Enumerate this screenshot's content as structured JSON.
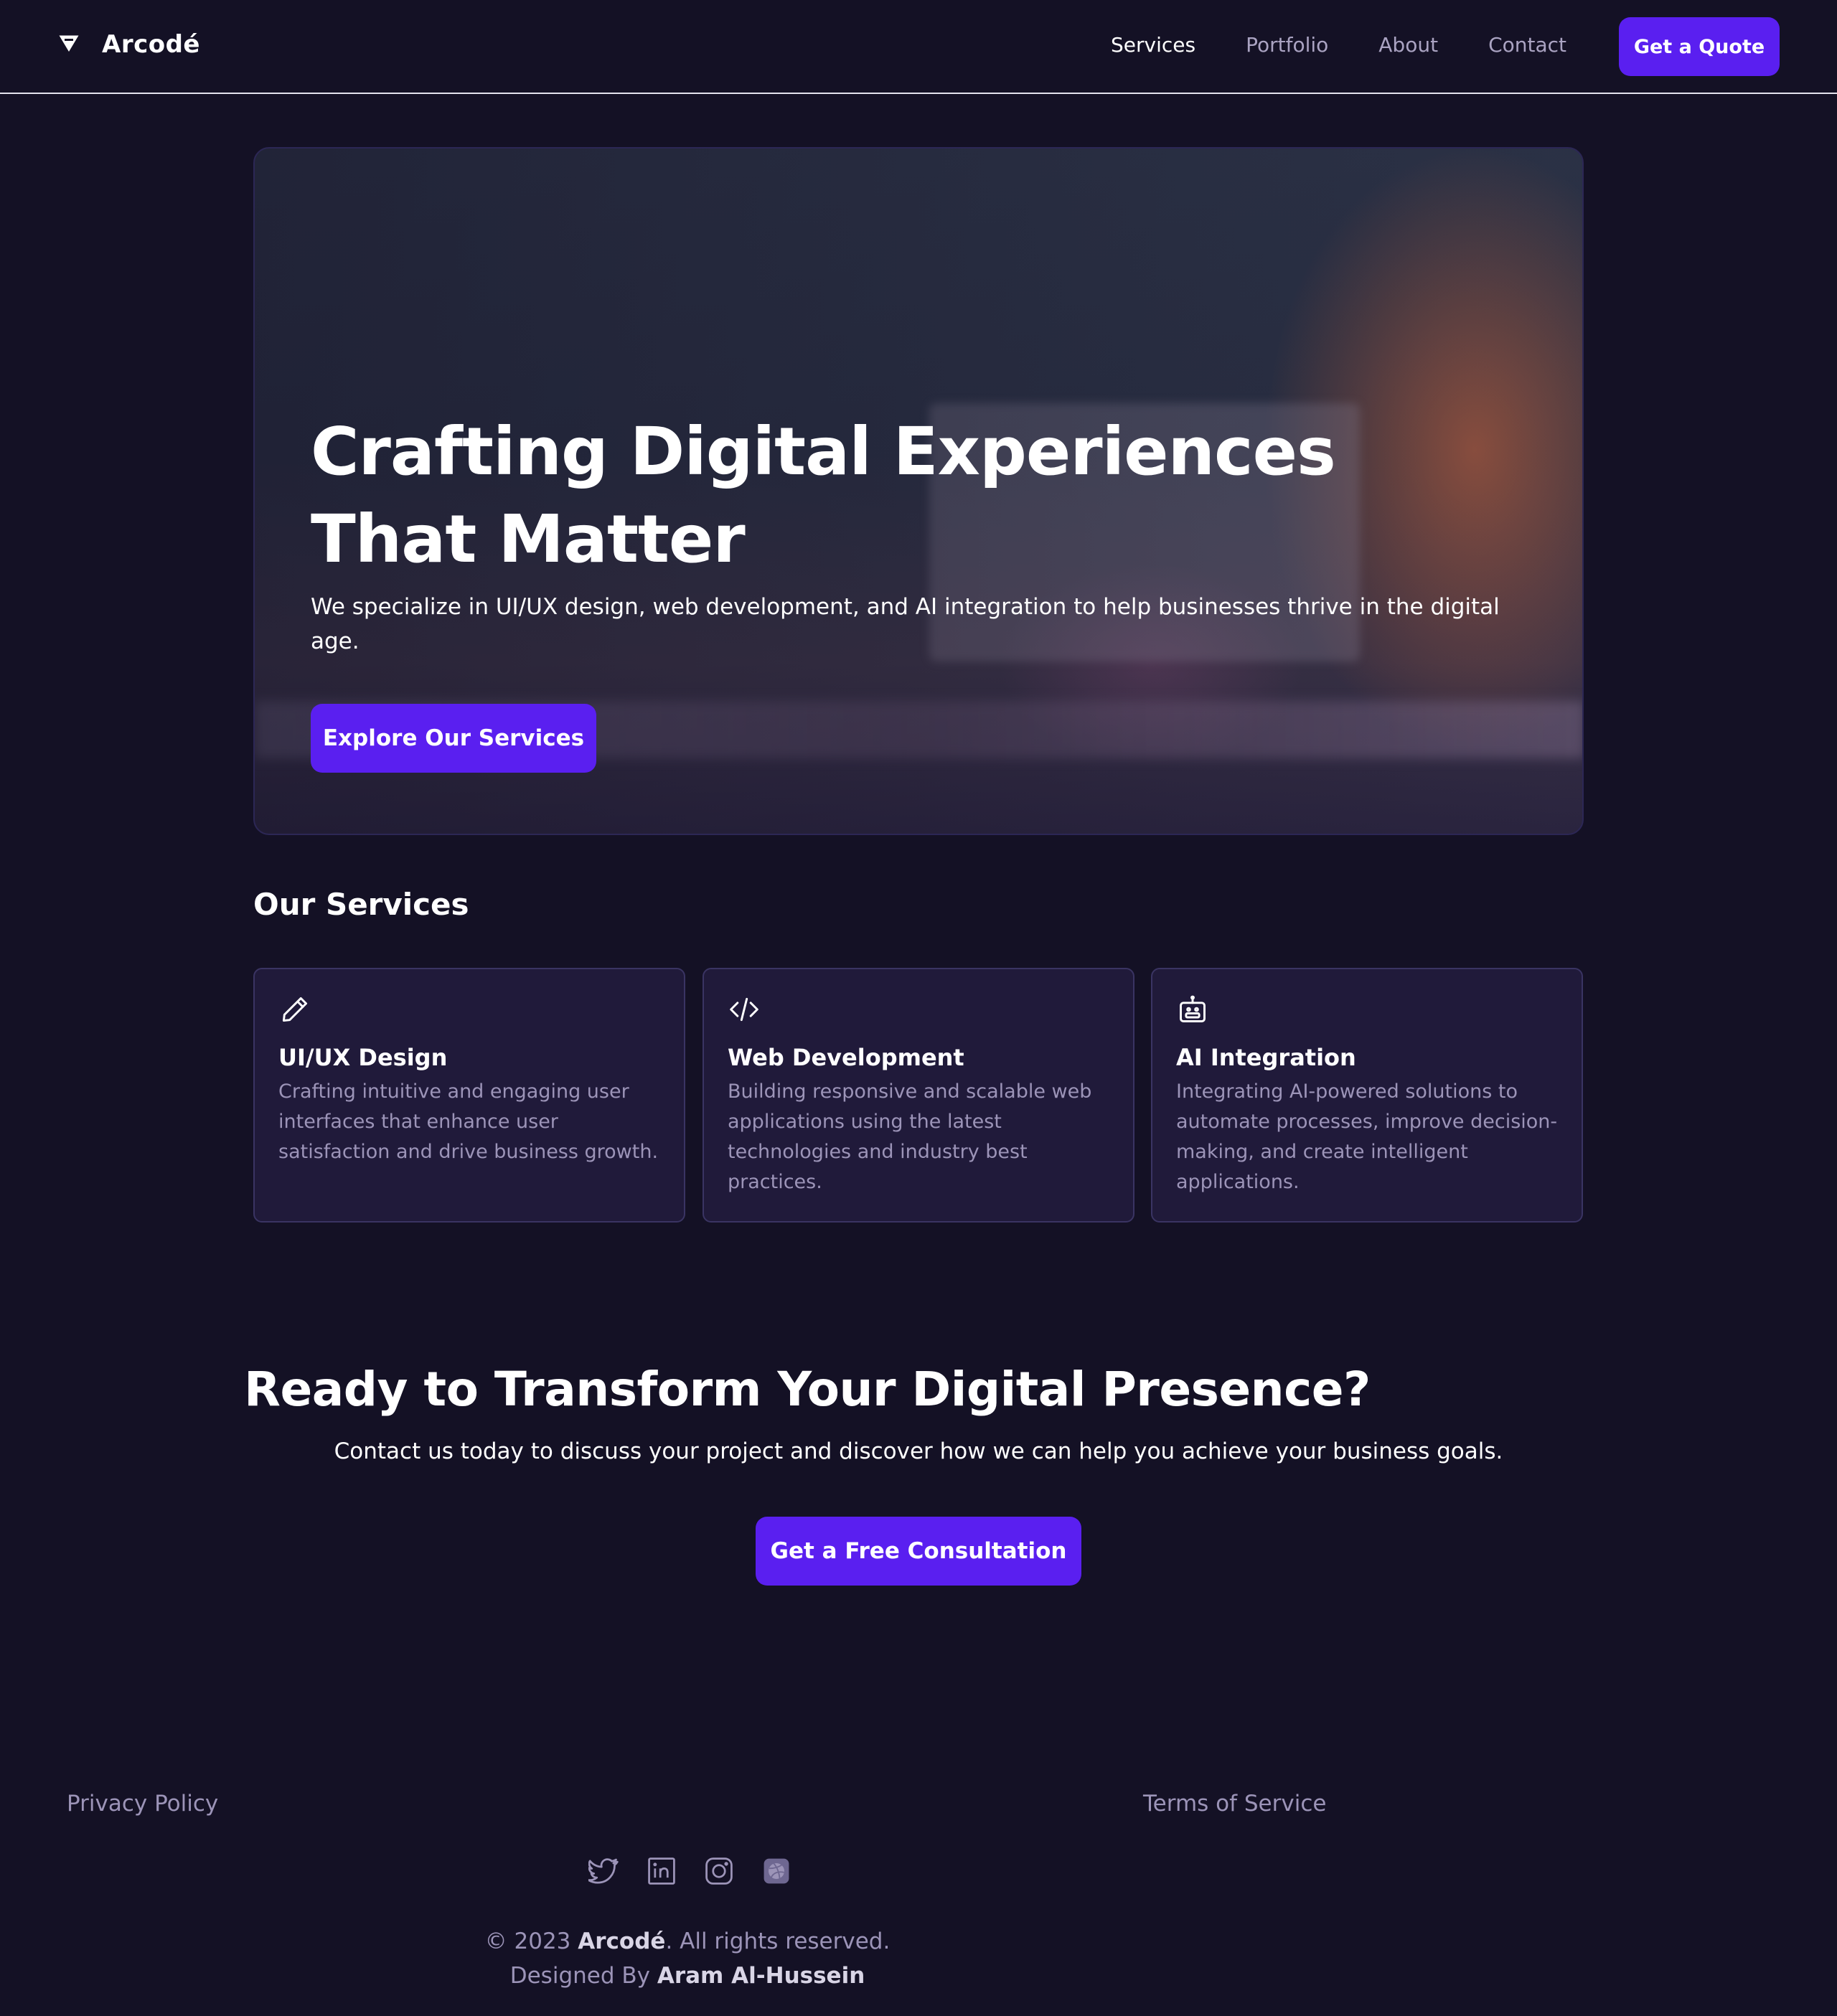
{
  "brand": {
    "name": "Arcodé"
  },
  "nav": {
    "items": [
      "Services",
      "Portfolio",
      "About",
      "Contact"
    ],
    "active": "Services",
    "cta_label": "Get a Quote"
  },
  "hero": {
    "title": "Crafting Digital Experiences That Matter",
    "subtitle": "We specialize in UI/UX design, web development, and AI integration to help businesses thrive in the digital age.",
    "button_label": "Explore Our Services"
  },
  "services": {
    "title": "Our Services",
    "cards": [
      {
        "icon": "pencil-icon",
        "title": "UI/UX Design",
        "description": "Crafting intuitive and engaging user interfaces that enhance user satisfaction and drive business growth."
      },
      {
        "icon": "code-icon",
        "title": "Web Development",
        "description": "Building responsive and scalable web applications using the latest technologies and industry best practices."
      },
      {
        "icon": "robot-icon",
        "title": "AI Integration",
        "description": "Integrating AI-powered solutions to automate processes, improve decision-making, and create intelligent applications."
      }
    ]
  },
  "cta": {
    "title": "Ready to Transform Your Digital Presence?",
    "subtitle": "Contact us today to discuss your project and discover how we can help you achieve your business goals.",
    "button_label": "Get a Free Consultation"
  },
  "footer": {
    "privacy": "Privacy Policy",
    "terms": "Terms of Service",
    "social_icons": [
      "twitter-icon",
      "linkedin-icon",
      "instagram-icon",
      "dribbble-icon"
    ],
    "copyright_prefix": "© 2023",
    "copyright_brand": "Arcodé",
    "copyright_suffix": ". All rights reserved.",
    "designed_prefix": "Designed By",
    "designer": "Aram Al-Hussein"
  },
  "colors": {
    "background": "#141125",
    "accent": "#5a1ff0",
    "card": "#201a3a",
    "muted_text": "#9c94b8"
  }
}
